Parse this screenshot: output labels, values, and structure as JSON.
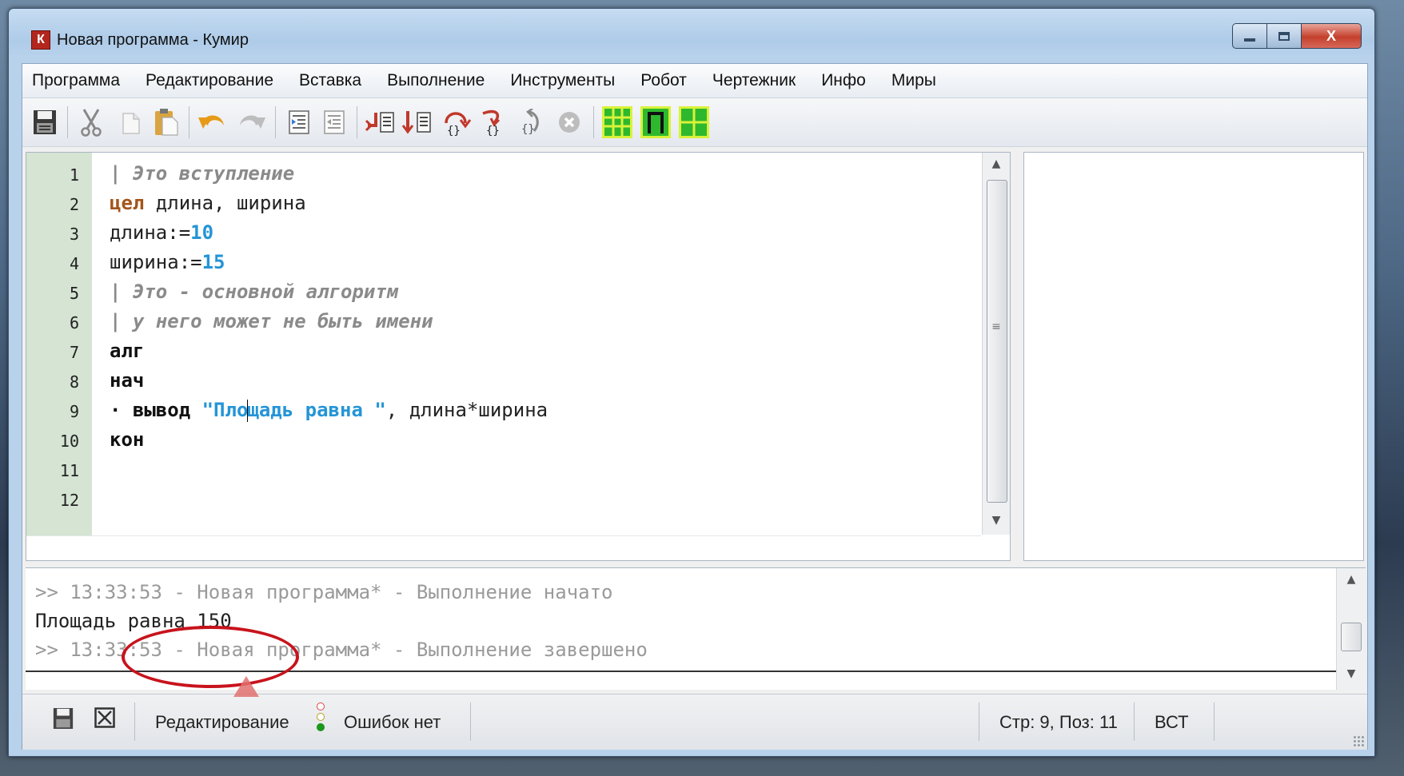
{
  "window": {
    "title": "Новая программа - Кумир",
    "app_icon_letter": "К",
    "controls": {
      "minimize": "minimize-icon",
      "maximize": "maximize-icon",
      "close": "close-icon",
      "close_glyph": "X"
    }
  },
  "menu": [
    "Программа",
    "Редактирование",
    "Вставка",
    "Выполнение",
    "Инструменты",
    "Робот",
    "Чертежник",
    "Инфо",
    "Миры"
  ],
  "toolbar": {
    "icons": [
      "save-icon",
      "cut-icon",
      "copy-icon",
      "paste-icon",
      "undo-icon",
      "redo-icon",
      "indent-icon",
      "outdent-icon",
      "run-icon",
      "step-icon",
      "step-over-icon",
      "step-into-icon",
      "step-out-icon",
      "stop-icon",
      "robot-world-icon",
      "draftsman-world-icon",
      "coordinates-icon"
    ],
    "colors": {
      "world_green": "#2eb82e",
      "world_bg": "#d9f23a",
      "undo_orange": "#e79a18"
    }
  },
  "editor": {
    "line_numbers": [
      "1",
      "2",
      "3",
      "4",
      "5",
      "6",
      "7",
      "8",
      "9",
      "10",
      "11",
      "12"
    ],
    "lines": {
      "l1": "| Это вступление",
      "l2_kw": "цел",
      "l2_rest": " длина, ширина",
      "l3_var": "длина:=",
      "l3_num": "10",
      "l4_var": "ширина:=",
      "l4_num": "15",
      "l5": "| Это - основной алгоритм",
      "l6": "| у него может не быть имени",
      "l7": "алг",
      "l8": "нач",
      "l9_bullet": "·",
      "l9_kw": "вывод",
      "l9_str_a": "\"Пло",
      "l9_str_b": "щадь равна \"",
      "l9_rest": ", длина*ширина",
      "l10": "кон"
    },
    "colors": {
      "gutter": "#d5e4d3",
      "keyword_type": "#a4541b",
      "literal": "#2495d6",
      "comment": "#8a8a8a"
    }
  },
  "console": {
    "line1": ">> 13:33:53 - Новая программа* - Выполнение начато",
    "line2": "Площадь равна 150",
    "line3": ">> 13:33:53 - Новая программа* - Выполнение завершено"
  },
  "status": {
    "mode": "Редактирование",
    "errors": "Ошибок нет",
    "position": "Стр: 9, Поз: 11",
    "insert_mode": "ВСТ"
  },
  "annotation": {
    "highlight_color": "#c8131c"
  }
}
